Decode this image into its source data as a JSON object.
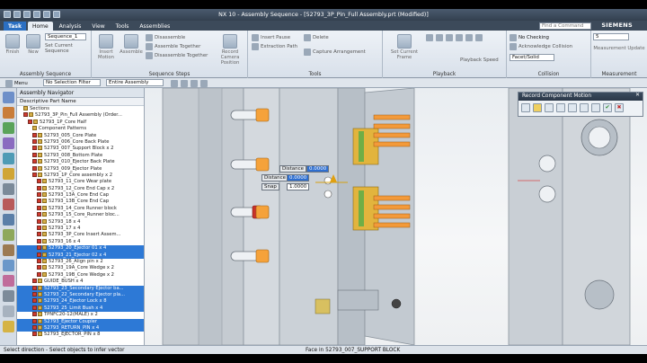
{
  "window": {
    "title": "NX 10 - Assembly Sequence - [52793_3P_Pin_Full Assembly.prt (Modified)]",
    "brand": "SIEMENS"
  },
  "tabs": [
    {
      "label": "Task"
    },
    {
      "label": "Home"
    },
    {
      "label": "Analysis"
    },
    {
      "label": "View"
    },
    {
      "label": "Tools"
    },
    {
      "label": "Assemblies"
    }
  ],
  "command_finder": {
    "placeholder": "Find a Command"
  },
  "ribbon": {
    "groups": {
      "assembly_sequence": "Assembly Sequence",
      "sequence_steps": "Sequence Steps",
      "tools": "Tools",
      "playback": "Playback",
      "collision": "Collision",
      "measurement": "Measurement"
    },
    "buttons": {
      "finish": "Finish",
      "new": "New",
      "set_current": "Set Current Sequence",
      "sequence_dropdown": "Sequence_1",
      "insert_motion": "Insert Motion",
      "assemble": "Assemble",
      "disassemble": "Disassemble",
      "assemble_together": "Assemble Together",
      "disassemble_together": "Disassemble Together",
      "record_camera": "Record Camera Position",
      "insert_pause": "Insert Pause",
      "extraction_path": "Extraction Path",
      "delete": "Delete",
      "capture_arrangement": "Capture Arrangement",
      "set_current_frame": "Set Current Frame",
      "playback_speed": "Playback Speed",
      "no_checking": "No Checking",
      "acknowledge_collision": "Acknowledge Collision",
      "facet_solid": "Facet/Solid",
      "speed_value": "5",
      "measurement_update": "Measurement Update"
    }
  },
  "selection_bar": {
    "menu": "Menu",
    "filter": "No Selection Filter",
    "scope": "Entire Assembly"
  },
  "navigator": {
    "title": "Assembly Navigator",
    "column": "Descriptive Part Name",
    "rows": [
      {
        "label": "Sections",
        "indent": 1,
        "check": false,
        "selected": false
      },
      {
        "label": "52793_3P_Pin_Full Assembly (Order...",
        "indent": 1,
        "check": true,
        "selected": false
      },
      {
        "label": "52793_1P_Core Half",
        "indent": 2,
        "check": true,
        "selected": false
      },
      {
        "label": "Component Patterns",
        "indent": 3,
        "check": false,
        "selected": false
      },
      {
        "label": "52793_005_Core Plate",
        "indent": 3,
        "check": true,
        "selected": false
      },
      {
        "label": "52793_006_Core Back Plate",
        "indent": 3,
        "check": true,
        "selected": false
      },
      {
        "label": "52793_007_Support Block x 2",
        "indent": 3,
        "check": true,
        "selected": false
      },
      {
        "label": "52793_008_Bottom Plate",
        "indent": 3,
        "check": true,
        "selected": false
      },
      {
        "label": "52793_010_Ejector Back Plate",
        "indent": 3,
        "check": true,
        "selected": false
      },
      {
        "label": "52793_009_Ejector Plate",
        "indent": 3,
        "check": true,
        "selected": false
      },
      {
        "label": "52793_1P_Core assembly x 2",
        "indent": 3,
        "check": true,
        "selected": false
      },
      {
        "label": "52793_11_Core Wear plate",
        "indent": 4,
        "check": true,
        "selected": false
      },
      {
        "label": "52793_12_Core End Cap x 2",
        "indent": 4,
        "check": true,
        "selected": false
      },
      {
        "label": "52793_13A_Core End Cap",
        "indent": 4,
        "check": true,
        "selected": false
      },
      {
        "label": "52793_13B_Core End Cap",
        "indent": 4,
        "check": true,
        "selected": false
      },
      {
        "label": "52793_14_Core Runner block",
        "indent": 4,
        "check": true,
        "selected": false
      },
      {
        "label": "52793_15_Core_Runner bloc...",
        "indent": 4,
        "check": true,
        "selected": false
      },
      {
        "label": "52793_18 x 4",
        "indent": 4,
        "check": true,
        "selected": false
      },
      {
        "label": "52793_17 x 4",
        "indent": 4,
        "check": true,
        "selected": false
      },
      {
        "label": "52793_3P_Core Insert Assem...",
        "indent": 4,
        "check": true,
        "selected": false
      },
      {
        "label": "52793_16 x 4",
        "indent": 4,
        "check": true,
        "selected": false
      },
      {
        "label": "52793_20_Ejector 01 x 4",
        "indent": 4,
        "check": true,
        "selected": true
      },
      {
        "label": "52793_21_Ejector 02 x 4",
        "indent": 4,
        "check": true,
        "selected": true
      },
      {
        "label": "52793_26_Align pin x 2",
        "indent": 4,
        "check": true,
        "selected": false
      },
      {
        "label": "52793_19A_Core Wedge x 2",
        "indent": 4,
        "check": true,
        "selected": false
      },
      {
        "label": "52793_19B_Core Wedge x 2",
        "indent": 4,
        "check": true,
        "selected": false
      },
      {
        "label": "GUIDE_BUSH x 4",
        "indent": 3,
        "check": true,
        "selected": false
      },
      {
        "label": "52793_23_Secondary Ejector ba...",
        "indent": 3,
        "check": true,
        "selected": true
      },
      {
        "label": "52793_22_Secondary Ejector pla...",
        "indent": 3,
        "check": true,
        "selected": true
      },
      {
        "label": "52793_24_Ejector Lock x 8",
        "indent": 3,
        "check": true,
        "selected": true
      },
      {
        "label": "52793_25_Limit Bush x 4",
        "indent": 3,
        "check": true,
        "selected": true
      },
      {
        "label": "TPNFC20-12(MALE) x 2",
        "indent": 3,
        "check": true,
        "selected": false
      },
      {
        "label": "52793_Ejector Coupler",
        "indent": 3,
        "check": true,
        "selected": true
      },
      {
        "label": "52793_RETURN_PIN x 4",
        "indent": 3,
        "check": true,
        "selected": true
      },
      {
        "label": "52793_EJECTOR_PIN x 8",
        "indent": 3,
        "check": true,
        "selected": false
      }
    ]
  },
  "dialog": {
    "title": "Record Component Motion"
  },
  "float_input": {
    "distance_label": "Distance",
    "distance_value": "0.0000",
    "distance2_label": "Distance",
    "distance2_value": "0.0000",
    "snap_label": "Snap",
    "snap_value": "1.0000"
  },
  "status": {
    "left": "Select direction - Select objects to infer vector",
    "mid": "Face in 52793_007_SUPPORT BLOCK"
  }
}
